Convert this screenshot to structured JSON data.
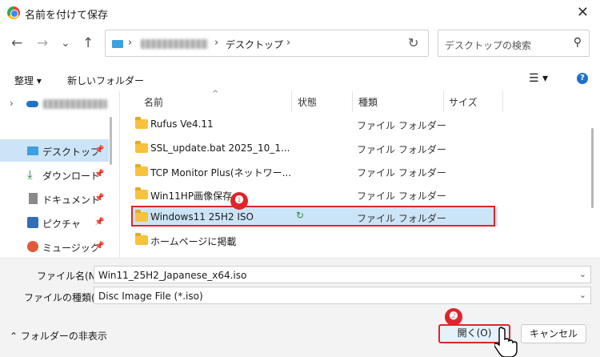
{
  "window": {
    "title": "名前を付けて保存",
    "close_icon": "close-icon"
  },
  "nav": {
    "back": "←",
    "forward": "→",
    "recent": "⌄",
    "up": "↑",
    "breadcrumb": [
      "デスクトップ"
    ],
    "refresh": "↻",
    "search_placeholder": "デスクトップの検索"
  },
  "toolbar": {
    "organize": "整理 ▾",
    "new_folder": "新しいフォルダー",
    "view": "☰ ▾",
    "help": "?"
  },
  "sidebar": {
    "items": [
      {
        "label": "デスクトップ",
        "icon": "desktop-icon",
        "selected": true
      },
      {
        "label": "ダウンロード",
        "icon": "download-icon"
      },
      {
        "label": "ドキュメント",
        "icon": "document-icon"
      },
      {
        "label": "ピクチャ",
        "icon": "picture-icon"
      },
      {
        "label": "ミュージック",
        "icon": "music-icon"
      }
    ]
  },
  "columns": {
    "name": "名前",
    "status": "状態",
    "type": "種類",
    "size": "サイズ"
  },
  "files": [
    {
      "name": "Rufus Ve4.11",
      "type": "ファイル フォルダー"
    },
    {
      "name": "SSL_update.bat 2025_10_1...",
      "type": "ファイル フォルダー"
    },
    {
      "name": "TCP Monitor Plus(ネットワー...",
      "type": "ファイル フォルダー"
    },
    {
      "name": "Win11HP画像保存",
      "type": "ファイル フォルダー"
    },
    {
      "name": "Windows11 25H2 ISO",
      "type": "ファイル フォルダー",
      "status": "↻",
      "selected": true
    },
    {
      "name": "ホームページに掲載",
      "type": ""
    }
  ],
  "annotations": {
    "one": "❶",
    "two": "❷"
  },
  "bottom": {
    "filename_label": "ファイル名(N):",
    "filename_value": "Win11_25H2_Japanese_x64.iso",
    "filetype_label": "ファイルの種類(T):",
    "filetype_value": "Disc Image File (*.iso)",
    "hide_folders": "フォルダーの非表示",
    "open_button": "開く(O)",
    "cancel_button": "キャンセル"
  },
  "colors": {
    "accent_red": "#e0242b",
    "selection": "#cce4f7",
    "folder": "#f7c33a"
  }
}
